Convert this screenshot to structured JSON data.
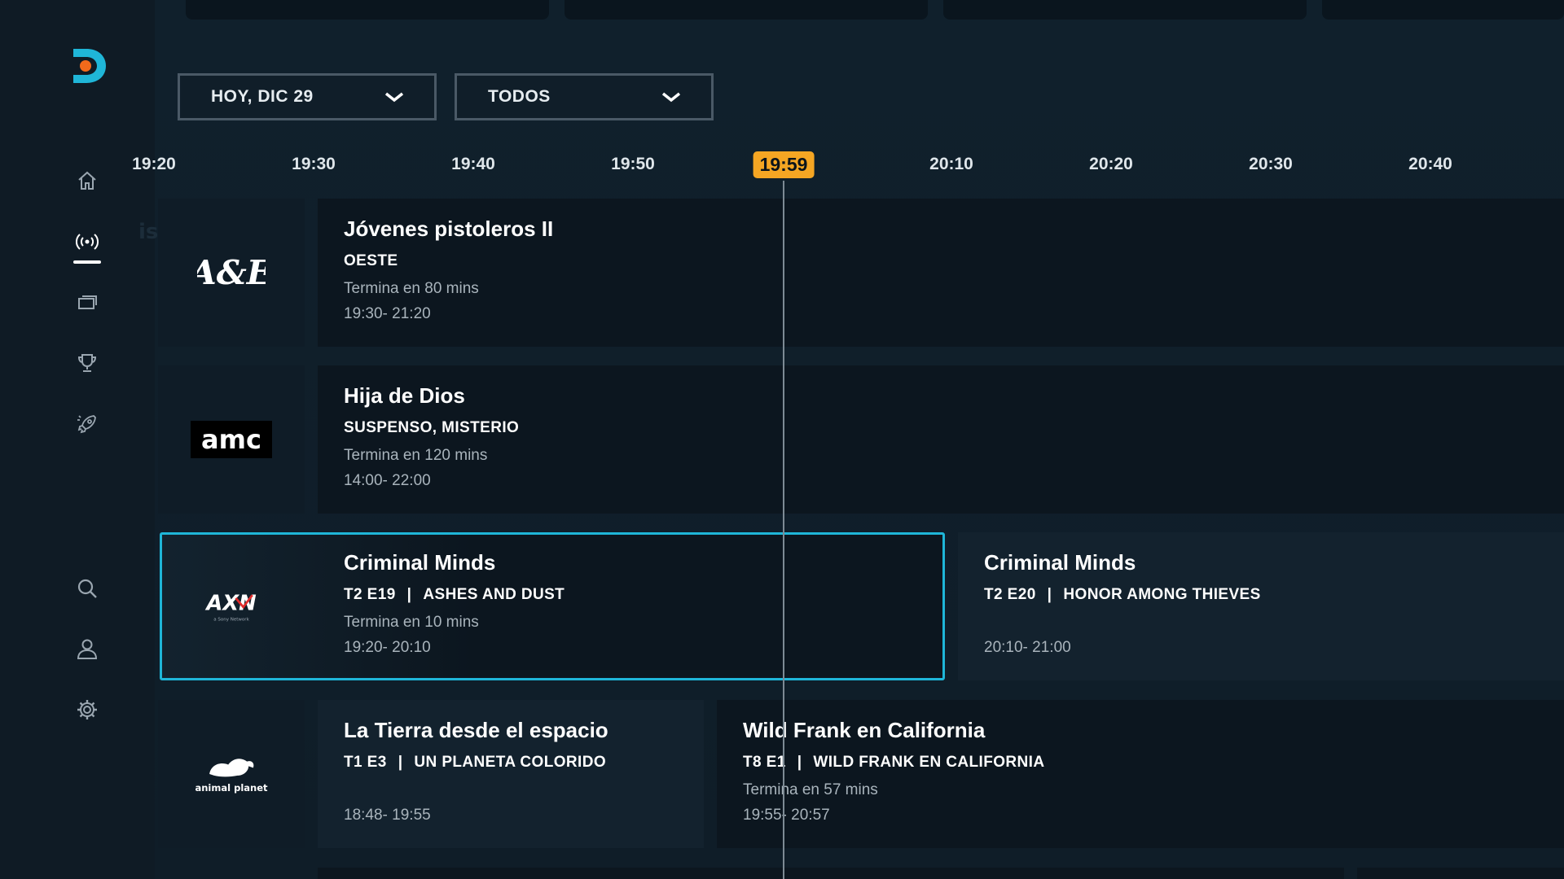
{
  "sidebar": {
    "nav": [
      {
        "icon": "home-icon"
      },
      {
        "icon": "live-broadcast-icon",
        "active": true
      },
      {
        "icon": "tv-series-icon"
      },
      {
        "icon": "trophy-icon"
      },
      {
        "icon": "rocket-icon"
      },
      {
        "icon": "search-icon"
      },
      {
        "icon": "user-icon"
      },
      {
        "icon": "gear-icon"
      }
    ]
  },
  "filters": {
    "date": "HOY, DIC 29",
    "category": "TODOS"
  },
  "timeline": {
    "ticks": [
      "19:20",
      "19:30",
      "19:40",
      "19:50",
      "20:10",
      "20:20",
      "20:30",
      "20:40"
    ],
    "now": "19:59"
  },
  "faded_label": "isión",
  "channels": [
    {
      "logo": "A&E",
      "programs": [
        {
          "title": "Jóvenes pistoleros II",
          "meta": "OESTE",
          "remaining": "Termina en 80 mins",
          "time": "19:30- 21:20"
        }
      ]
    },
    {
      "logo": "amc",
      "programs": [
        {
          "title": "Hija de Dios",
          "meta": "SUSPENSO, MISTERIO",
          "remaining": "Termina en 120 mins",
          "time": "14:00- 22:00"
        }
      ]
    },
    {
      "logo": "AXN",
      "logo_sub": "a Sony Network",
      "programs": [
        {
          "title": "Criminal Minds",
          "episode": "T2 E19",
          "separator": "|",
          "episode_title": "ASHES AND DUST",
          "remaining": "Termina en 10 mins",
          "time": "19:20- 20:10"
        },
        {
          "title": "Criminal Minds",
          "episode": "T2 E20",
          "separator": "|",
          "episode_title": "HONOR AMONG THIEVES",
          "time": "20:10- 21:00"
        }
      ]
    },
    {
      "logo": "animal planet",
      "programs": [
        {
          "title": "La Tierra desde el espacio",
          "episode": "T1 E3",
          "separator": "|",
          "episode_title": "UN PLANETA COLORIDO",
          "time": "18:48- 19:55"
        },
        {
          "title": "Wild Frank en California",
          "episode": "T8 E1",
          "separator": "|",
          "episode_title": "WILD FRANK EN CALIFORNIA",
          "remaining": "Termina en 57 mins",
          "time": "19:55- 20:57"
        }
      ]
    }
  ],
  "colors": {
    "accent": "#1fb6d8",
    "now_badge": "#f5a623",
    "background": "#0f1c27"
  }
}
